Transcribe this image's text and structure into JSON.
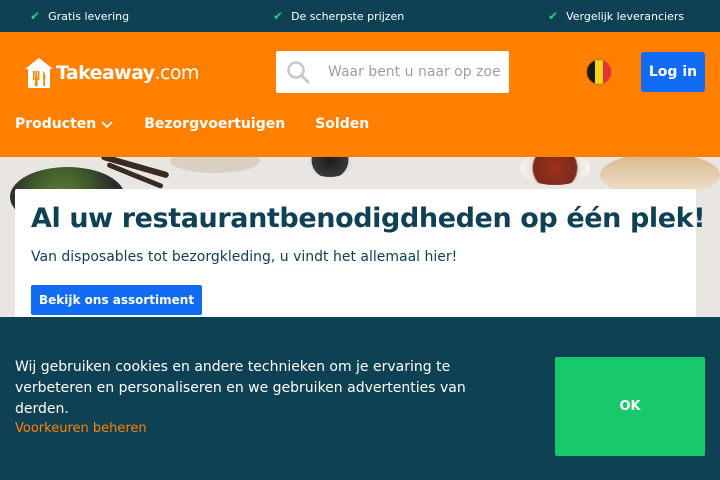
{
  "usp": [
    {
      "label": "Gratis levering"
    },
    {
      "label": "De scherpste prijzen"
    },
    {
      "label": "Vergelijk leveranciers"
    }
  ],
  "header": {
    "logo_text_main": "Takeaway",
    "logo_text_dot": ".com",
    "search_placeholder": "Waar bent u naar op zoek?",
    "login_label": "Log in",
    "language_flag": "belgium-flag",
    "nav": [
      {
        "label": "Producten",
        "has_dropdown": true
      },
      {
        "label": "Bezorgvoertuigen"
      },
      {
        "label": "Solden"
      }
    ]
  },
  "hero": {
    "title": "Al uw restaurantbenodigdheden op één plek!",
    "subtitle": "Van disposables tot bezorgkleding, u vindt het allemaal hier!",
    "cta_label": "Bekijk ons assortiment"
  },
  "cookie": {
    "text": "Wij gebruiken cookies en andere technieken om je ervaring te verbeteren en personaliseren en we gebruiken advertenties van derden.",
    "link_label": "Voorkeuren beheren",
    "ok_label": "OK"
  },
  "colors": {
    "brand_orange": "#ff8000",
    "navy": "#0f4154",
    "primary_blue": "#126bf3",
    "ok_green": "#18c96b",
    "check_green": "#27d27a"
  }
}
